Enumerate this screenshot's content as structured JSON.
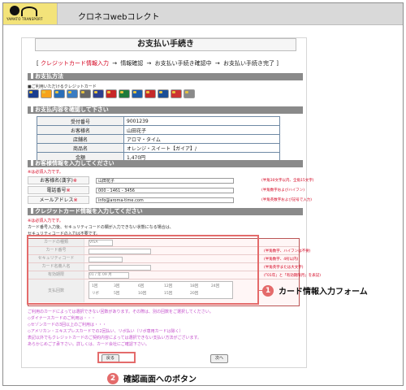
{
  "header": {
    "logo_text": "YAMATO TRANSPORT",
    "app_title": "クロネコwebコレクト"
  },
  "page": {
    "title": "お支払い手続き",
    "steps": [
      {
        "label": "クレジットカード情報入力",
        "active": true
      },
      {
        "label": "情報確認",
        "active": false
      },
      {
        "label": "お支払い手続き確認中",
        "active": false
      },
      {
        "label": "お支払い手続き完了",
        "active": false
      }
    ],
    "steps_open": "[",
    "steps_close": "]",
    "arrow": "→"
  },
  "payment_method": {
    "heading": "お支払方法",
    "note": "■ご利用いただけるクレジットカード",
    "cards": [
      {
        "name": "VISA",
        "color": "#1a3d8f"
      },
      {
        "name": "MasterCard",
        "color": "#f7a21b"
      },
      {
        "name": "JCB",
        "color": "#2a6eb8"
      },
      {
        "name": "AMEX",
        "color": "#3a7cc2"
      },
      {
        "name": "Diners",
        "color": "#666666"
      },
      {
        "name": "DC",
        "color": "#2c3f8f"
      },
      {
        "name": "UFJ",
        "color": "#c72727"
      },
      {
        "name": "NICOS",
        "color": "#1e7b3c"
      },
      {
        "name": "UC",
        "color": "#1f5ca8"
      },
      {
        "name": "MUFG",
        "color": "#c52a2a"
      },
      {
        "name": "SAISON",
        "color": "#1b4e96"
      },
      {
        "name": "TOP",
        "color": "#cc3333"
      },
      {
        "name": "OTHER",
        "color": "#8a8a8a"
      }
    ]
  },
  "order": {
    "heading": "お支払内容を確認して下さい",
    "rows": [
      {
        "key": "受付番号",
        "value": "9001239"
      },
      {
        "key": "お客様名",
        "value": "山田花子"
      },
      {
        "key": "店舗名",
        "value": "アロマ・タイム"
      },
      {
        "key": "商品名",
        "value": "オレンジ・スイート【ガイア】/"
      },
      {
        "key": "金額",
        "value": "1,470円"
      }
    ]
  },
  "customer": {
    "heading": "お客様情報を入力してください",
    "required_note": "※は必須入力です。",
    "fields": [
      {
        "key": "お客様名(漢字)",
        "value": "山田花子",
        "hint": "(半角30文字以内、全角15文字)"
      },
      {
        "key": "電話番号",
        "value": "000 - 1461 - 3456",
        "hint": "(半角数字およびハイフン)"
      },
      {
        "key": "メールアドレス",
        "value": "info@aroma-time.com",
        "hint": "(半角英数字および記号で入力)"
      }
    ],
    "required_mark": "※"
  },
  "credit_card": {
    "heading": "クレジットカード情報を入力してください",
    "notes": [
      {
        "text": "※は必須入力です。",
        "color": "red"
      },
      {
        "text": "カード番号入力後、セキュリティコードの欄が入力できない状態になる場合は、",
        "color": "dark"
      },
      {
        "text": "セキュリティコードの入力は不要です。",
        "color": "dark"
      }
    ],
    "rows": [
      {
        "key": "カードの種類",
        "kind": "select",
        "value": "VISA",
        "hint": ""
      },
      {
        "key": "カード番号",
        "kind": "input",
        "value": "",
        "hint": "(半角数字、ハイフンは不要)"
      },
      {
        "key": "セキュリティコード",
        "kind": "input",
        "value": "",
        "hint": "(半角数字、4桁以内)"
      },
      {
        "key": "カード名義人名",
        "kind": "input",
        "value": "",
        "hint": "(半角英字または大文字)"
      },
      {
        "key": "有効期限",
        "kind": "select",
        "value": "01 / 年 09 月",
        "hint": "(「01年」と「有効期限月」を表記)"
      }
    ],
    "installment": {
      "key": "支払回数",
      "options": [
        "1回",
        "リボ",
        "3回",
        "5回",
        "6回",
        "10回",
        "12回",
        "15回",
        "18回",
        "20回",
        "24回"
      ]
    }
  },
  "footer_notes": [
    {
      "text": "ご利用のカードによっては選択できない回数があります。その際は、別の回数をご選択してください。",
      "color": "pink"
    },
    {
      "text": "◇ダイナースカードのご利用は・・・",
      "color": "pink"
    },
    {
      "text": "◇セゾンカードの3回以上のご利用は・・・",
      "color": "pink"
    },
    {
      "text": "◇アメリカン・エキスプレスカードでの2回払い、リボ払い（リボ専用カードは除く）",
      "color": "pink"
    },
    {
      "text": "表記以外でもクレジットカードのご契約内容によっては選択できない支払い方法がございます。",
      "color": "pink"
    },
    {
      "text": "あらかじめご了承下さい。詳しくは、カード会社にご確認下さい。",
      "color": "pink"
    }
  ],
  "buttons": {
    "back": "戻る",
    "next": "次へ"
  },
  "annotations": [
    {
      "num": "1",
      "label": "カード情報入力フォーム",
      "color": "#e46b6b"
    },
    {
      "num": "2",
      "label": "確認画面へのボタン",
      "color": "#e46b6b"
    }
  ]
}
